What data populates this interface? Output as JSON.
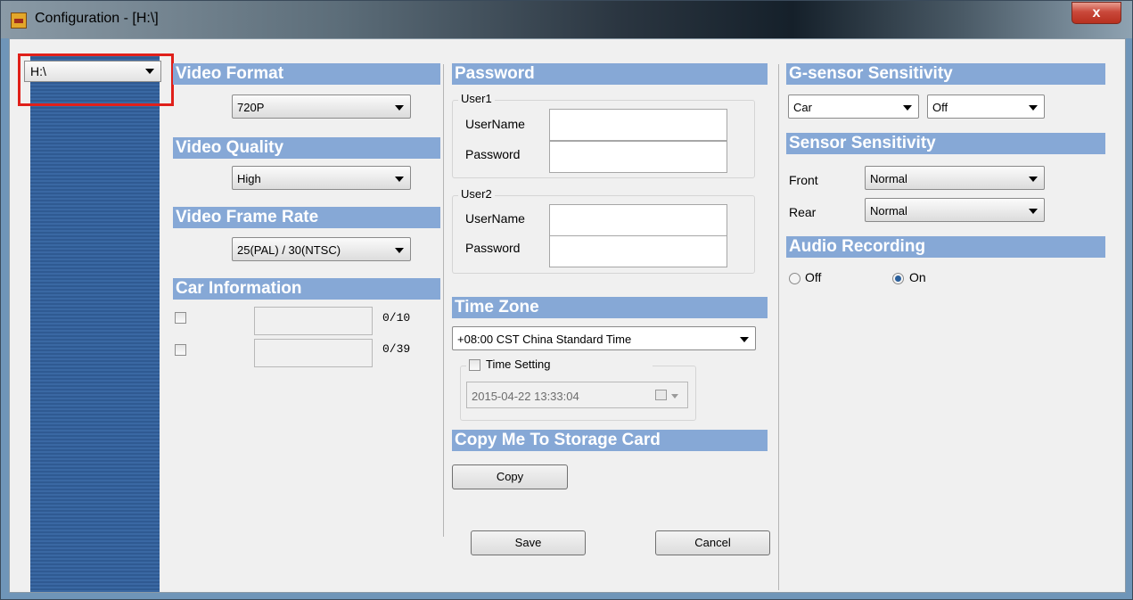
{
  "window": {
    "title": "Configuration - [H:\\]",
    "close_label": "x"
  },
  "drive": {
    "value": "H:\\"
  },
  "video_format": {
    "header": "Video Format",
    "value": "720P"
  },
  "video_quality": {
    "header": "Video Quality",
    "value": "High"
  },
  "video_frame_rate": {
    "header": "Video Frame Rate",
    "value": "25(PAL) / 30(NTSC)"
  },
  "car_info": {
    "header": "Car Information",
    "rows": [
      {
        "count": "0/10"
      },
      {
        "count": "0/39"
      }
    ]
  },
  "password": {
    "header": "Password",
    "user1": {
      "title": "User1",
      "username_label": "UserName",
      "password_label": "Password"
    },
    "user2": {
      "title": "User2",
      "username_label": "UserName",
      "password_label": "Password"
    }
  },
  "time_zone": {
    "header": "Time Zone",
    "value": "+08:00 CST China Standard Time",
    "time_setting_label": "Time Setting",
    "datetime": "2015-04-22 13:33:04"
  },
  "copy": {
    "header": "Copy Me To Storage Card",
    "button": "Copy"
  },
  "actions": {
    "save": "Save",
    "cancel": "Cancel"
  },
  "g_sensor": {
    "header": "G-sensor Sensitivity",
    "mode": "Car",
    "level": "Off"
  },
  "sensor_sensitivity": {
    "header": "Sensor Sensitivity",
    "front_label": "Front",
    "front_value": "Normal",
    "rear_label": "Rear",
    "rear_value": "Normal"
  },
  "audio": {
    "header": "Audio Recording",
    "off_label": "Off",
    "on_label": "On",
    "selected": "On"
  },
  "colors": {
    "header_bg": "#86a8d6",
    "sidebar": "#2f5a92",
    "highlight": "#e0201a"
  }
}
